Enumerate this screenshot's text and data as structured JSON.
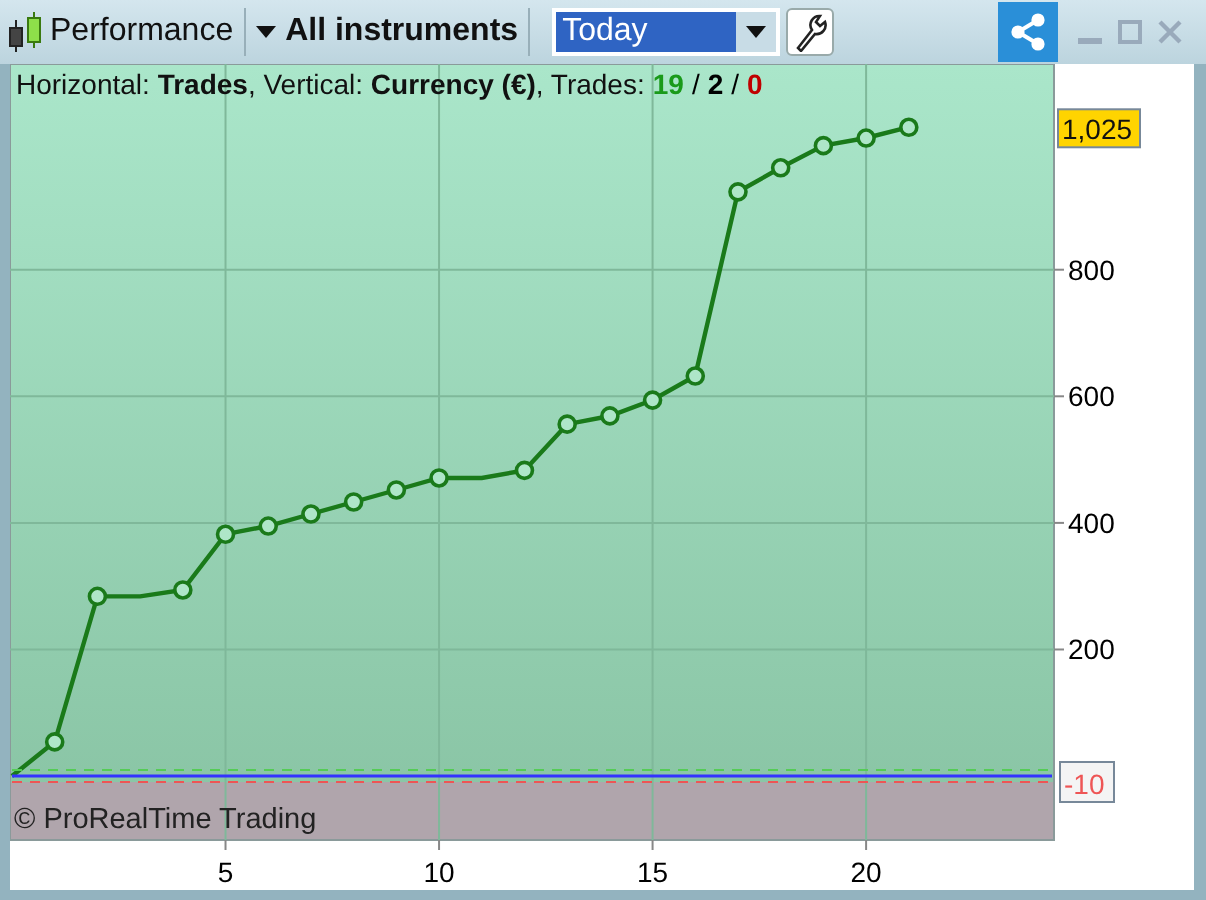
{
  "toolbar": {
    "title": "Performance",
    "scope": "All instruments",
    "period": {
      "value": "Today"
    }
  },
  "header": {
    "text": "Horizontal: **Trades**, Vertical: **Currency (€)**, Trades:",
    "parts": [
      {
        "kind": "count",
        "text": "19",
        "color": "#1a9a1a"
      },
      {
        "kind": "separator",
        "text": "/",
        "color": "#000000"
      },
      {
        "kind": "count",
        "text": "2",
        "color": "#000000"
      },
      {
        "kind": "separator",
        "text": "/",
        "color": "#000000"
      },
      {
        "kind": "count",
        "text": "0",
        "color": "#c00000"
      }
    ]
  },
  "watermark_text": "© ProRealTime Trading",
  "threshold_tag": "-10",
  "chart_data": {
    "type": "line",
    "x": [
      0,
      1,
      2,
      3,
      4,
      5,
      6,
      7,
      8,
      9,
      10,
      11,
      12,
      13,
      14,
      15,
      16,
      17,
      18,
      19,
      20,
      21
    ],
    "grid": true,
    "series": [
      {
        "color": "#1a7a1a",
        "marker": "circle",
        "values": [
          0,
          54,
          284,
          284,
          294,
          382,
          395,
          414,
          433,
          452,
          471,
          471,
          483,
          556,
          569,
          594,
          632,
          923,
          961,
          996,
          1008,
          1025
        ]
      }
    ],
    "xlim": [
      0,
      24.4
    ],
    "ylim": [
      -101,
      1125
    ],
    "xticks": [
      5,
      10,
      15,
      20
    ],
    "yticks": [
      200,
      400,
      600,
      800
    ],
    "annotations": [
      {
        "y": 1025,
        "text": "1,025"
      }
    ]
  }
}
